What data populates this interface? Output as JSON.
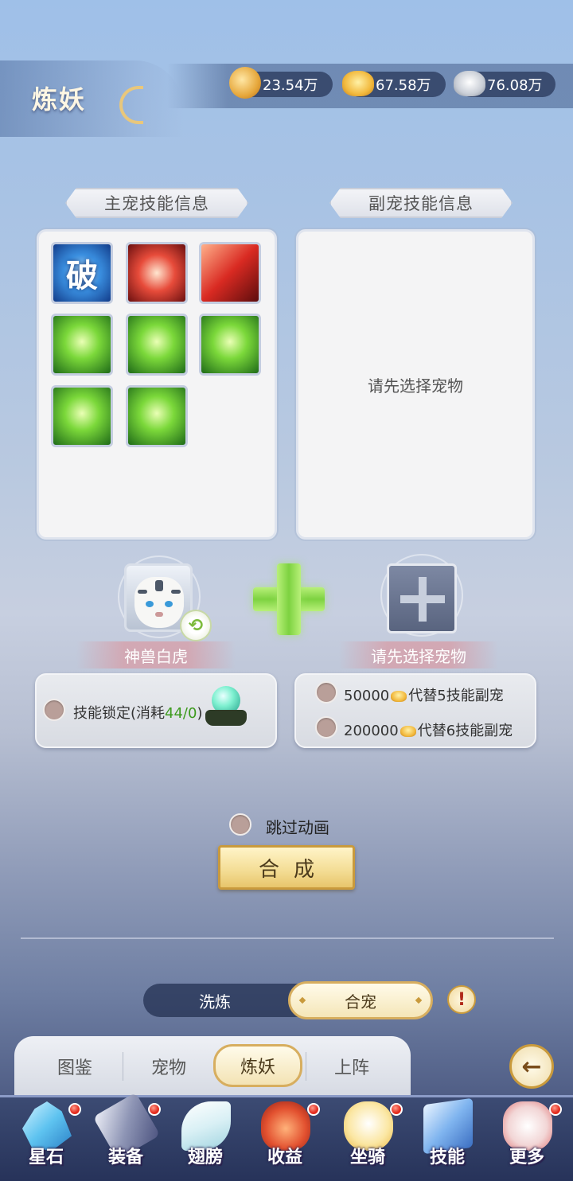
{
  "header": {
    "title": "炼妖",
    "resources": [
      {
        "icon": "dragon-coin-icon",
        "value": "23.54万"
      },
      {
        "icon": "gold-ingot-icon",
        "value": "67.58万"
      },
      {
        "icon": "silver-ingot-icon",
        "value": "76.08万"
      }
    ]
  },
  "main_panel": {
    "title": "主宠技能信息",
    "skills": [
      {
        "icon": "break-skill-icon",
        "glyph": "破",
        "color": "blue"
      },
      {
        "icon": "lightning-fist-skill-icon",
        "glyph": "",
        "color": "red1"
      },
      {
        "icon": "fire-slash-skill-icon",
        "glyph": "",
        "color": "red2"
      },
      {
        "icon": "wind-dash-skill-icon",
        "glyph": "",
        "color": "green"
      },
      {
        "icon": "beast-roar-skill-icon",
        "glyph": "",
        "color": "green"
      },
      {
        "icon": "swift-run-skill-icon",
        "glyph": "",
        "color": "green"
      },
      {
        "icon": "spirit-shadow-skill-icon",
        "glyph": "",
        "color": "green"
      },
      {
        "icon": "forest-sword-skill-icon",
        "glyph": "",
        "color": "green"
      }
    ]
  },
  "sub_panel": {
    "title": "副宠技能信息",
    "empty_text": "请先选择宠物"
  },
  "main_pet": {
    "name": "神兽白虎"
  },
  "sub_pet": {
    "name": "请先选择宠物"
  },
  "lock_option": {
    "label_prefix": "技能锁定(消耗",
    "label_count": "44/0",
    "label_suffix": ")"
  },
  "replace_options": [
    {
      "amount": "50000",
      "text": "代替5技能副宠"
    },
    {
      "amount": "200000",
      "text": "代替6技能副宠"
    }
  ],
  "skip_animation": "跳过动画",
  "synth_button": "合成",
  "sub_toggle": {
    "left": "洗炼",
    "right": "合宠"
  },
  "help_label": "!",
  "tabs": [
    "图鉴",
    "宠物",
    "炼妖",
    "上阵"
  ],
  "active_tab": "炼妖",
  "bottom_nav": [
    {
      "label": "星石",
      "icon": "crystal-icon",
      "badge": true
    },
    {
      "label": "装备",
      "icon": "hammer-icon",
      "badge": true
    },
    {
      "label": "翅膀",
      "icon": "wing-icon",
      "badge": false
    },
    {
      "label": "收益",
      "icon": "money-bag-icon",
      "badge": true
    },
    {
      "label": "坐骑",
      "icon": "horse-icon",
      "badge": true
    },
    {
      "label": "技能",
      "icon": "skill-book-icon",
      "badge": false
    },
    {
      "label": "更多",
      "icon": "gamepad-icon",
      "badge": true
    }
  ]
}
